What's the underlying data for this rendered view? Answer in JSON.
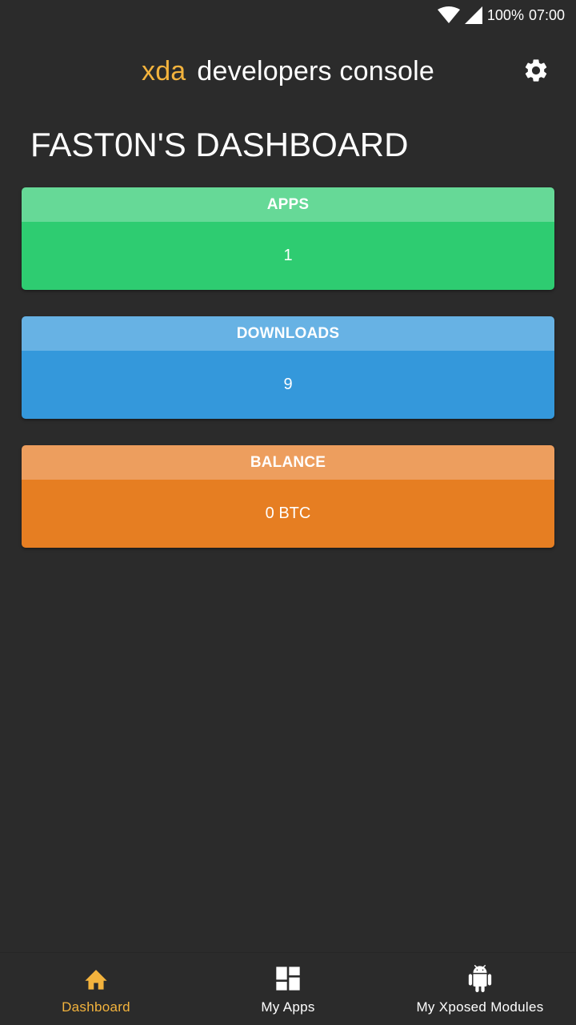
{
  "status_bar": {
    "battery": "100%",
    "time": "07:00",
    "icons": [
      "wifi-icon",
      "cell-signal-icon"
    ]
  },
  "header": {
    "brand": "xda",
    "title": "developers console",
    "settings_icon": "gear-icon"
  },
  "page": {
    "title": "FAST0N'S DASHBOARD"
  },
  "cards": [
    {
      "label": "APPS",
      "value": "1",
      "header_color": "#66d997",
      "body_color": "#2ecc71"
    },
    {
      "label": "DOWNLOADS",
      "value": "9",
      "header_color": "#67b2e4",
      "body_color": "#3498db"
    },
    {
      "label": "BALANCE",
      "value": "0 BTC",
      "header_color": "#ed9e5e",
      "body_color": "#e67e22"
    }
  ],
  "bottom_nav": {
    "items": [
      {
        "label": "Dashboard",
        "icon": "home-icon",
        "active": true
      },
      {
        "label": "My Apps",
        "icon": "dashboard-grid-icon",
        "active": false
      },
      {
        "label": "My Xposed Modules",
        "icon": "android-icon",
        "active": false
      }
    ]
  },
  "colors": {
    "background": "#2b2b2b",
    "accent": "#f3b33d",
    "text": "#ffffff"
  }
}
